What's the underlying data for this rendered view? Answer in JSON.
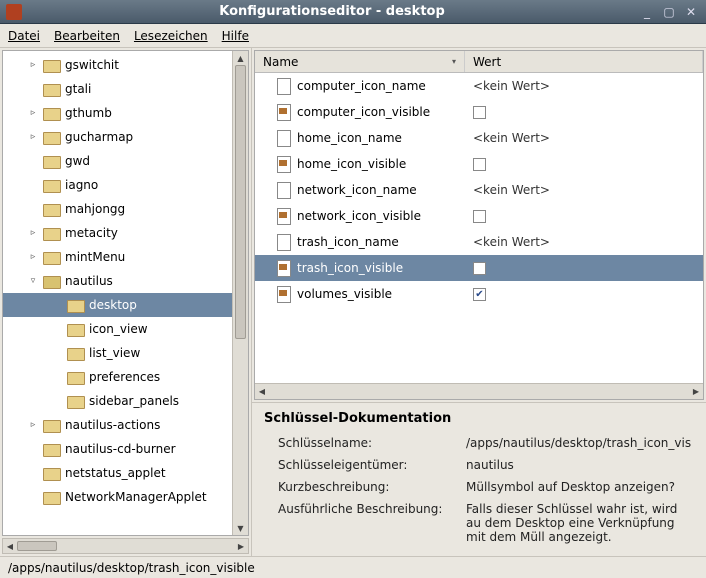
{
  "window": {
    "title": "Konfigurationseditor - desktop"
  },
  "menubar": {
    "datei": "Datei",
    "bearbeiten": "Bearbeiten",
    "lesezeichen": "Lesezeichen",
    "hilfe": "Hilfe"
  },
  "tree": {
    "items": [
      {
        "depth": 1,
        "expander": "▹",
        "label": "gswitchit"
      },
      {
        "depth": 1,
        "expander": "",
        "label": "gtali"
      },
      {
        "depth": 1,
        "expander": "▹",
        "label": "gthumb"
      },
      {
        "depth": 1,
        "expander": "▹",
        "label": "gucharmap"
      },
      {
        "depth": 1,
        "expander": "",
        "label": "gwd"
      },
      {
        "depth": 1,
        "expander": "",
        "label": "iagno"
      },
      {
        "depth": 1,
        "expander": "",
        "label": "mahjongg"
      },
      {
        "depth": 1,
        "expander": "▹",
        "label": "metacity"
      },
      {
        "depth": 1,
        "expander": "▹",
        "label": "mintMenu"
      },
      {
        "depth": 1,
        "expander": "▿",
        "label": "nautilus",
        "open": true
      },
      {
        "depth": 2,
        "expander": "",
        "label": "desktop",
        "selected": true
      },
      {
        "depth": 2,
        "expander": "",
        "label": "icon_view"
      },
      {
        "depth": 2,
        "expander": "",
        "label": "list_view"
      },
      {
        "depth": 2,
        "expander": "",
        "label": "preferences"
      },
      {
        "depth": 2,
        "expander": "",
        "label": "sidebar_panels"
      },
      {
        "depth": 1,
        "expander": "▹",
        "label": "nautilus-actions"
      },
      {
        "depth": 1,
        "expander": "",
        "label": "nautilus-cd-burner"
      },
      {
        "depth": 1,
        "expander": "",
        "label": "netstatus_applet"
      },
      {
        "depth": 1,
        "expander": "",
        "label": "NetworkManagerApplet"
      }
    ]
  },
  "table": {
    "headers": {
      "name": "Name",
      "wert": "Wert"
    },
    "rows": [
      {
        "type": "string",
        "name": "computer_icon_name",
        "value": "<kein Wert>"
      },
      {
        "type": "bool",
        "name": "computer_icon_visible",
        "checked": false
      },
      {
        "type": "string",
        "name": "home_icon_name",
        "value": "<kein Wert>"
      },
      {
        "type": "bool",
        "name": "home_icon_visible",
        "checked": false
      },
      {
        "type": "string",
        "name": "network_icon_name",
        "value": "<kein Wert>"
      },
      {
        "type": "bool",
        "name": "network_icon_visible",
        "checked": false
      },
      {
        "type": "string",
        "name": "trash_icon_name",
        "value": "<kein Wert>"
      },
      {
        "type": "bool",
        "name": "trash_icon_visible",
        "checked": false,
        "selected": true
      },
      {
        "type": "bool",
        "name": "volumes_visible",
        "checked": true
      }
    ]
  },
  "doc": {
    "heading": "Schlüssel-Dokumentation",
    "labels": {
      "name": "Schlüsselname:",
      "owner": "Schlüsseleigentümer:",
      "short": "Kurzbeschreibung:",
      "long": "Ausführliche Beschreibung:"
    },
    "values": {
      "name": "/apps/nautilus/desktop/trash_icon_vis",
      "owner": "nautilus",
      "short": "Müllsymbol auf Desktop anzeigen?",
      "long": "Falls dieser Schlüssel wahr ist, wird au dem Desktop eine Verknüpfung mit dem Müll angezeigt."
    }
  },
  "statusbar": {
    "path": "/apps/nautilus/desktop/trash_icon_visible"
  }
}
